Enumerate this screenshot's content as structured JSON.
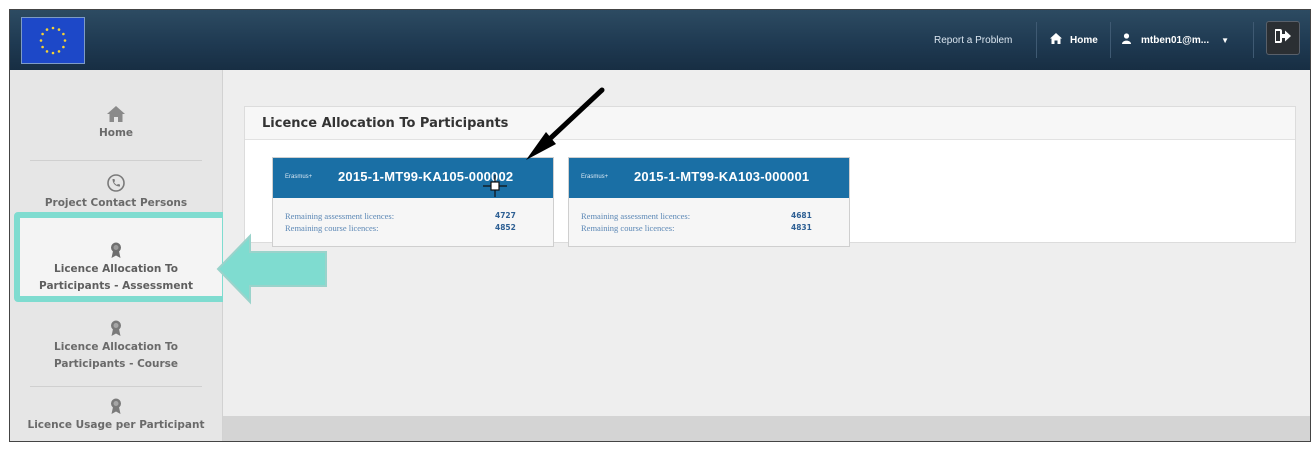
{
  "topbar": {
    "report_label": "Report a Problem",
    "home_label": "Home",
    "user_label": "mtben01@m...",
    "icons": {
      "home": "home-icon",
      "user": "user-icon",
      "logout": "sign-out-icon",
      "caret": "chevron-down-icon"
    }
  },
  "sidebar": {
    "items": [
      {
        "label": "Home",
        "icon": "home-icon"
      },
      {
        "label": "Project Contact Persons",
        "icon": "phone-icon"
      },
      {
        "label_line1": "Licence Allocation To",
        "label_line2": "Participants - Assessment",
        "icon": "award-icon"
      },
      {
        "label_line1": "Licence Allocation To",
        "label_line2": "Participants - Course",
        "icon": "award-icon"
      },
      {
        "label": "Licence Usage per Participant",
        "icon": "award-icon"
      }
    ]
  },
  "panel": {
    "title": "Licence Allocation To Participants",
    "cards": [
      {
        "logo": "Erasmus+",
        "code": "2015-1-MT99-KA105-000002",
        "rows": [
          {
            "label": "Remaining assessment licences:",
            "value": "4727"
          },
          {
            "label": "Remaining course licences:",
            "value": "4852"
          }
        ]
      },
      {
        "logo": "Erasmus+",
        "code": "2015-1-MT99-KA103-000001",
        "rows": [
          {
            "label": "Remaining assessment licences:",
            "value": "4681"
          },
          {
            "label": "Remaining course licences:",
            "value": "4831"
          }
        ]
      }
    ]
  },
  "colors": {
    "topbar": "#1f3a52",
    "card_header": "#1a6fa5",
    "highlight": "#7fdcd0",
    "sidebar_bg": "#e6e6e6"
  }
}
